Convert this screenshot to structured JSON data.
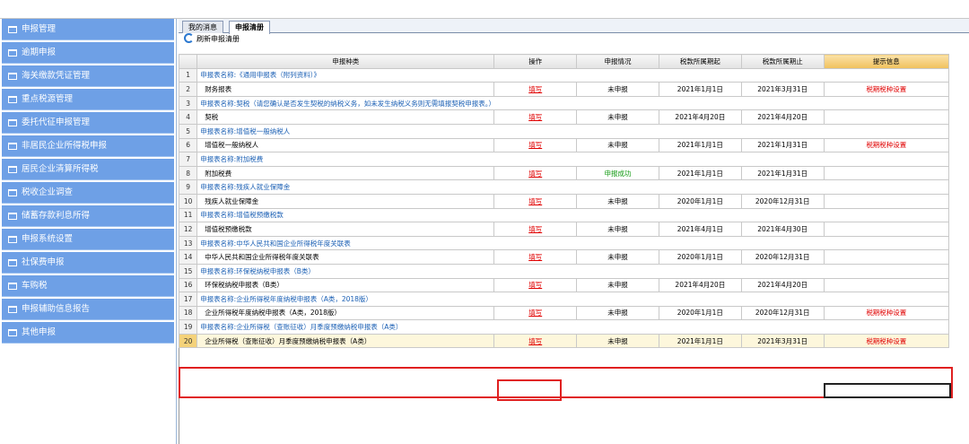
{
  "sidebar": {
    "items": [
      {
        "label": "申报管理"
      },
      {
        "label": "逾期申报"
      },
      {
        "label": "海关缴款凭证管理"
      },
      {
        "label": "重点税源管理"
      },
      {
        "label": "委托代征申报管理"
      },
      {
        "label": "非居民企业所得税申报"
      },
      {
        "label": "居民企业清算所得税"
      },
      {
        "label": "税收企业调查"
      },
      {
        "label": "储蓄存款利息所得"
      },
      {
        "label": "申报系统设置"
      },
      {
        "label": "社保费申报"
      },
      {
        "label": "车购税"
      },
      {
        "label": "申报辅助信息报告"
      },
      {
        "label": "其他申报"
      }
    ]
  },
  "tabs": [
    {
      "label": "我的消息",
      "active": false
    },
    {
      "label": "申报清册",
      "active": true
    }
  ],
  "toolbar": {
    "refresh_label": "刷新申报清册"
  },
  "table": {
    "headers": [
      "申报种类",
      "操作",
      "申报情况",
      "税款所属期起",
      "税款所属期止",
      "提示信息"
    ],
    "rows": [
      {
        "n": "1",
        "kind": "section",
        "name": "申报表名称:《通用申报表（附列资料）》"
      },
      {
        "n": "2",
        "kind": "item",
        "name": "财务报表",
        "op": "填写",
        "status": "未申报",
        "start": "2021年1月1日",
        "end": "2021年3月31日",
        "hint": "税期税种设置"
      },
      {
        "n": "3",
        "kind": "section",
        "name": "申报表名称:契税（请您确认是否发生契税的纳税义务，如未发生纳税义务则无需填报契税申报表。）"
      },
      {
        "n": "4",
        "kind": "item",
        "name": "契税",
        "op": "填写",
        "status": "未申报",
        "start": "2021年4月20日",
        "end": "2021年4月20日",
        "hint": ""
      },
      {
        "n": "5",
        "kind": "section",
        "name": "申报表名称:增值税一般纳税人"
      },
      {
        "n": "6",
        "kind": "item",
        "name": "增值税一般纳税人",
        "op": "填写",
        "status": "未申报",
        "start": "2021年1月1日",
        "end": "2021年1月31日",
        "hint": "税期税种设置"
      },
      {
        "n": "7",
        "kind": "section",
        "name": "申报表名称:附加税费"
      },
      {
        "n": "8",
        "kind": "item",
        "name": "附加税费",
        "op": "填写",
        "status": "申报成功",
        "start": "2021年1月1日",
        "end": "2021年1月31日",
        "hint": ""
      },
      {
        "n": "9",
        "kind": "section",
        "name": "申报表名称:残疾人就业保障金"
      },
      {
        "n": "10",
        "kind": "item",
        "name": "残疾人就业保障金",
        "op": "填写",
        "status": "未申报",
        "start": "2020年1月1日",
        "end": "2020年12月31日",
        "hint": ""
      },
      {
        "n": "11",
        "kind": "section",
        "name": "申报表名称:增值税预缴税款"
      },
      {
        "n": "12",
        "kind": "item",
        "name": "增值税预缴税款",
        "op": "填写",
        "status": "未申报",
        "start": "2021年4月1日",
        "end": "2021年4月30日",
        "hint": ""
      },
      {
        "n": "13",
        "kind": "section",
        "name": "申报表名称:中华人民共和国企业所得税年度关联表"
      },
      {
        "n": "14",
        "kind": "item",
        "name": "中华人民共和国企业所得税年度关联表",
        "op": "填写",
        "status": "未申报",
        "start": "2020年1月1日",
        "end": "2020年12月31日",
        "hint": ""
      },
      {
        "n": "15",
        "kind": "section",
        "name": "申报表名称:环保税纳税申报表（B类）"
      },
      {
        "n": "16",
        "kind": "item",
        "name": "环保税纳税申报表（B类）",
        "op": "填写",
        "status": "未申报",
        "start": "2021年4月20日",
        "end": "2021年4月20日",
        "hint": ""
      },
      {
        "n": "17",
        "kind": "section",
        "name": "申报表名称:企业所得税年度纳税申报表（A类，2018版）"
      },
      {
        "n": "18",
        "kind": "item",
        "name": "企业所得税年度纳税申报表（A类，2018版）",
        "op": "填写",
        "status": "未申报",
        "start": "2020年1月1日",
        "end": "2020年12月31日",
        "hint": "税期税种设置"
      },
      {
        "n": "19",
        "kind": "section",
        "name": "申报表名称:企业所得税（查账征收）月季度预缴纳税申报表（A类）"
      },
      {
        "n": "20",
        "kind": "item",
        "name": "企业所得税（查账征收）月季度预缴纳税申报表（A类）",
        "op": "填写",
        "status": "未申报",
        "start": "2021年1月1日",
        "end": "2021年3月31日",
        "hint": "税期税种设置"
      }
    ]
  }
}
